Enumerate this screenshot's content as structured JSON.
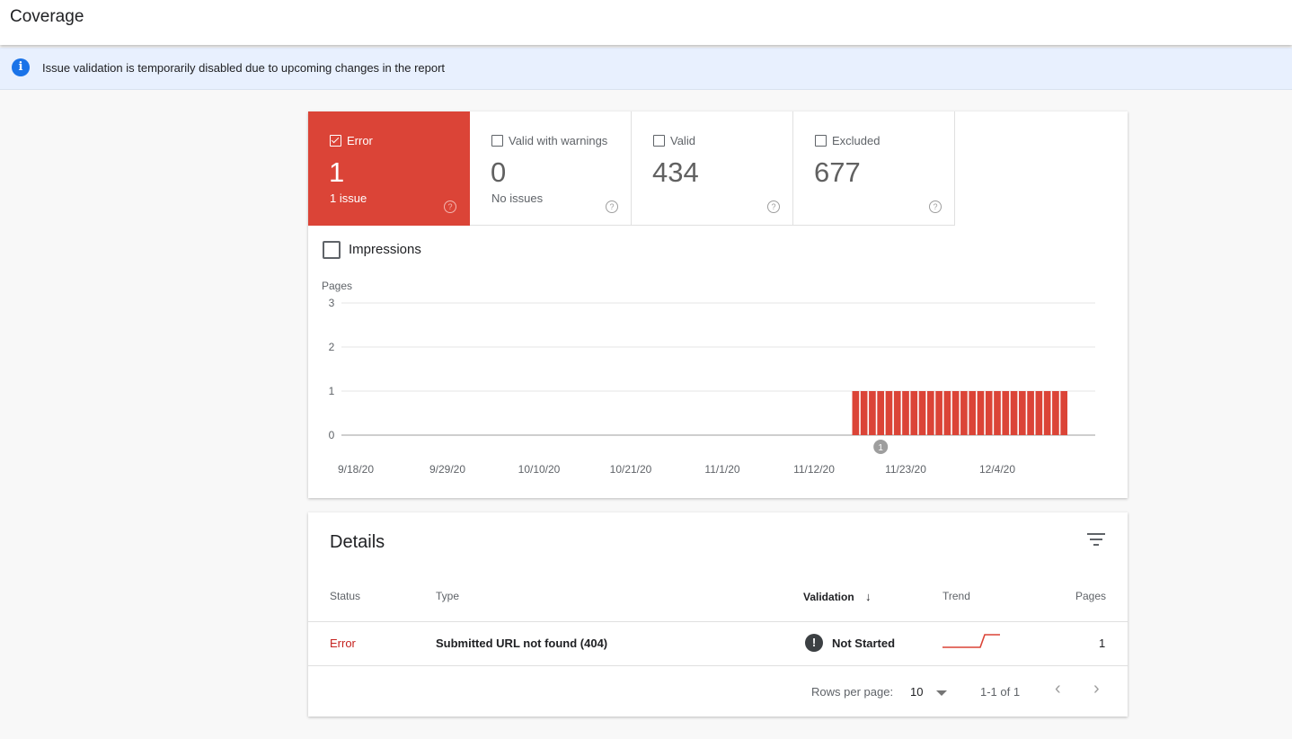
{
  "header": {
    "title": "Coverage"
  },
  "banner": {
    "icon": "info-icon",
    "message": "Issue validation is temporarily disabled due to upcoming changes in the report"
  },
  "summary": {
    "tiles": [
      {
        "label": "Error",
        "value": "1",
        "sub": "1 issue",
        "checked": true
      },
      {
        "label": "Valid with warnings",
        "value": "0",
        "sub": "No issues",
        "checked": false
      },
      {
        "label": "Valid",
        "value": "434",
        "sub": "",
        "checked": false
      },
      {
        "label": "Excluded",
        "value": "677",
        "sub": "",
        "checked": false
      }
    ],
    "help_glyph": "?",
    "impressions_label": "Impressions"
  },
  "chart_data": {
    "type": "bar",
    "ylabel": "Pages",
    "ylim": [
      0,
      3
    ],
    "y_ticks": [
      "0",
      "1",
      "2",
      "3"
    ],
    "x_tick_labels": [
      "9/18/20",
      "9/29/20",
      "10/10/20",
      "10/21/20",
      "11/1/20",
      "11/12/20",
      "11/23/20",
      "12/4/20"
    ],
    "x_range": [
      "9/18/20",
      "12/12/20"
    ],
    "series": [
      {
        "color": "#db4437",
        "points": [
          {
            "date": "11/17/20",
            "value": 1
          },
          {
            "date": "11/18/20",
            "value": 1
          },
          {
            "date": "11/19/20",
            "value": 1
          },
          {
            "date": "11/20/20",
            "value": 1
          },
          {
            "date": "11/21/20",
            "value": 1
          },
          {
            "date": "11/22/20",
            "value": 1
          },
          {
            "date": "11/23/20",
            "value": 1
          },
          {
            "date": "11/24/20",
            "value": 1
          },
          {
            "date": "11/25/20",
            "value": 1
          },
          {
            "date": "11/26/20",
            "value": 1
          },
          {
            "date": "11/27/20",
            "value": 1
          },
          {
            "date": "11/28/20",
            "value": 1
          },
          {
            "date": "11/29/20",
            "value": 1
          },
          {
            "date": "11/30/20",
            "value": 1
          },
          {
            "date": "12/1/20",
            "value": 1
          },
          {
            "date": "12/2/20",
            "value": 1
          },
          {
            "date": "12/3/20",
            "value": 1
          },
          {
            "date": "12/4/20",
            "value": 1
          },
          {
            "date": "12/5/20",
            "value": 1
          },
          {
            "date": "12/6/20",
            "value": 1
          },
          {
            "date": "12/7/20",
            "value": 1
          },
          {
            "date": "12/8/20",
            "value": 1
          },
          {
            "date": "12/9/20",
            "value": 1
          },
          {
            "date": "12/10/20",
            "value": 1
          },
          {
            "date": "12/11/20",
            "value": 1
          },
          {
            "date": "12/12/20",
            "value": 1
          }
        ]
      }
    ],
    "annotations": [
      {
        "date": "11/20/20",
        "label": "1"
      }
    ],
    "grid": true
  },
  "details": {
    "title": "Details",
    "columns": {
      "status": "Status",
      "type": "Type",
      "validation": "Validation",
      "trend": "Trend",
      "pages": "Pages"
    },
    "sort_arrow": "↓",
    "rows": [
      {
        "status": "Error",
        "type": "Submitted URL not found (404)",
        "validation": "Not Started",
        "validation_icon": "!",
        "pages": "1"
      }
    ],
    "footer": {
      "rows_per_page_label": "Rows per page:",
      "rows_per_page": "10",
      "range": "1-1 of 1",
      "prev": "‹",
      "next": "›"
    }
  },
  "colors": {
    "error": "#db4437",
    "info": "#1a73e8",
    "banner_bg": "#e8f0fe"
  }
}
